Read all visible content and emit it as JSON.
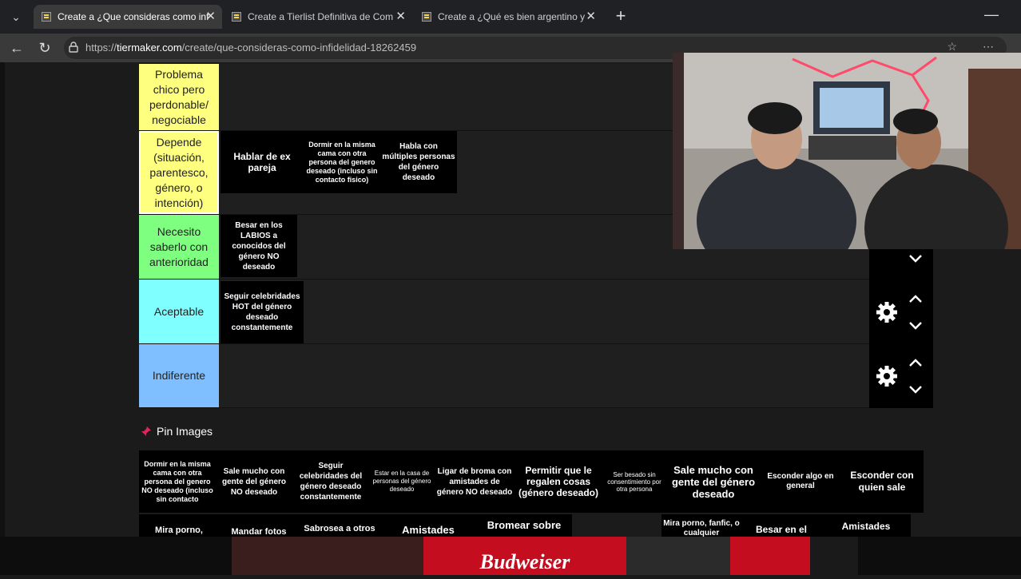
{
  "browser": {
    "tabs": [
      {
        "label": "Create a ¿Que consideras como infi",
        "active": true
      },
      {
        "label": "Create a Tierlist Definitiva de Com",
        "active": false
      },
      {
        "label": "Create a ¿Qué es bien argentino y",
        "active": false
      }
    ],
    "url_prefix": "https://",
    "url_domain": "tiermaker.com",
    "url_path": "/create/que-consideras-como-infidelidad-18262459"
  },
  "tiers": [
    {
      "label": "Problema chico pero perdonable/ negociable",
      "color": "#ffff7f",
      "items": []
    },
    {
      "label": "Depende (situación, parentesco, género, o intención)",
      "color": "#ffff7f",
      "items": [
        {
          "text": "Hablar de ex pareja"
        },
        {
          "text": "Dormir en la misma cama con otra persona del genero deseado (incluso sin contacto fisico)"
        },
        {
          "text": "Habla con múltiples personas del género deseado"
        }
      ]
    },
    {
      "label": "Necesito saberlo con anterioridad",
      "color": "#7fff7f",
      "items": [
        {
          "text": "Besar en los LABIOS a conocidos del género NO deseado"
        }
      ]
    },
    {
      "label": "Aceptable",
      "color": "#7fffff",
      "items": [
        {
          "text": "Seguir celebridades HOT del género deseado constantemente"
        }
      ]
    },
    {
      "label": "Indiferente",
      "color": "#7fbfff",
      "items": []
    }
  ],
  "pin_title": "Pin Images",
  "pool_row1": [
    {
      "text": "Dormir en la misma cama con otra persona del genero NO deseado (incluso sin contacto"
    },
    {
      "text": "Sale mucho con gente del género NO deseado"
    },
    {
      "text": "Seguir celebridades del género deseado constantemente"
    },
    {
      "text": "Estar en la casa de personas del género deseado"
    },
    {
      "text": "Ligar de broma con amistades de género NO deseado"
    },
    {
      "text": "Permitir que le regalen cosas (género deseado)"
    },
    {
      "text": "Ser besado sin consentimiento por otra persona"
    },
    {
      "text": "Sale mucho con gente del género deseado"
    },
    {
      "text": "Esconder algo en general"
    },
    {
      "text": "Esconder con quien sale"
    }
  ],
  "pool_row2": [
    {
      "text": "Mira porno,"
    },
    {
      "text": "Mandar fotos"
    },
    {
      "text": "Sabrosea a otros"
    },
    {
      "text": "Amistades"
    },
    {
      "text": "Bromear sobre"
    },
    {
      "text": "Mira porno, fanfic, o cualquier"
    },
    {
      "text": "Besar en el"
    },
    {
      "text": "Amistades"
    }
  ],
  "ad_brand": "Budweiser"
}
